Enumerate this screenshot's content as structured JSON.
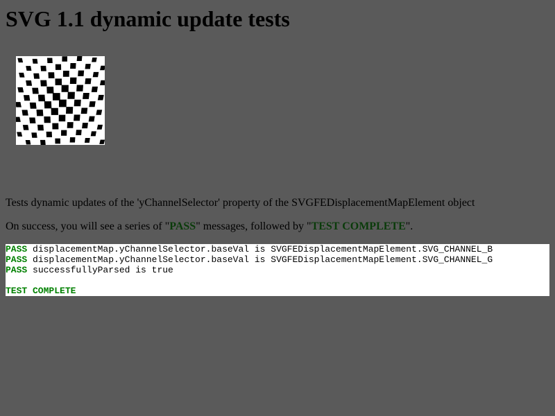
{
  "page": {
    "title": "SVG 1.1 dynamic update tests",
    "description": "Tests dynamic updates of the 'yChannelSelector' property of the SVGFEDisplacementMapElement object",
    "instructions": {
      "prefix": "On success, you will see a series of \"",
      "pass_word": "PASS",
      "middle": "\" messages, followed by \"",
      "complete_word": "TEST COMPLETE",
      "suffix": "\"."
    }
  },
  "console": {
    "lines": [
      {
        "status": "PASS",
        "message": " displacementMap.yChannelSelector.baseVal is SVGFEDisplacementMapElement.SVG_CHANNEL_B"
      },
      {
        "status": "PASS",
        "message": " displacementMap.yChannelSelector.baseVal is SVGFEDisplacementMapElement.SVG_CHANNEL_G"
      },
      {
        "status": "PASS",
        "message": " successfullyParsed is true"
      }
    ],
    "complete": "TEST COMPLETE"
  },
  "image": {
    "icon": "checkerboard-displacement-image",
    "colors": {
      "light": "#ffffff",
      "dark": "#000000"
    }
  }
}
